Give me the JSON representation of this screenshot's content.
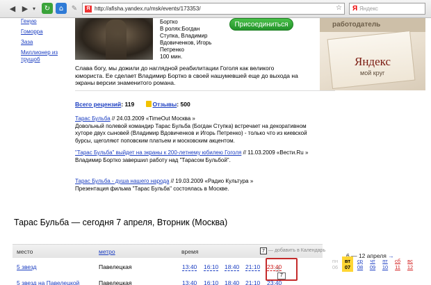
{
  "browser": {
    "url": "http://afisha.yandex.ru/msk/events/173353/",
    "favicon": "Я",
    "search_logo": "Я",
    "search_placeholder": "Яндекс",
    "icons": [
      "back-icon",
      "forward-icon",
      "dropdown-icon",
      "reload-icon",
      "home-icon",
      "pen-icon",
      "star-icon"
    ]
  },
  "sidebar": {
    "items": [
      "Геную",
      "Гоморра",
      "Заза",
      "Миллионер из трущоб"
    ]
  },
  "movie": {
    "meta_lines": [
      "Бортко",
      "В ролях:Богдан",
      "Ступка, Владимир",
      "Вдовиченков, Игорь",
      "Петренко",
      "100 мин."
    ],
    "join_button": "Присоединиться",
    "description": "Слава богу, мы дожили до наглядной реабилитации Гоголя как великого юмориста. Ее сделает Владимир Бортко в своей нашумевшей еще до выхода на экраны версии знаменитого романа."
  },
  "reviews": {
    "total_label": "Всего рецензий",
    "total_count": ": 119",
    "otzyvy_label": "Отзывы",
    "otzyvy_count": ": 500",
    "items": [
      {
        "link": "Тарас Бульба",
        "source": " // 24.03.2009 «TimeOut Москва »",
        "text": "Довольный полевой командир Тарас Бульба (Богдан Ступка) встречает на декоративном хуторе двух сыновей (Владимир Вдовиченков и Игорь Петренко) - только что из киевской бурсы, щеголяют поповским платьем и московским акцентом."
      },
      {
        "link": "\"Тарас Бульба\" выйдет на экраны к 200-летнему юбилею Гоголя",
        "source": " // 11.03.2009 «Вести.Ru »",
        "text": "Владимир Бортко завершил работу над \"Тарасом Бульбой\"."
      },
      {
        "link": "Тарас Бульба - душа нашего народа",
        "source": " // 19.03.2009 «Радио Культура »",
        "text": "Презентация фильма \"Тарас Бульба\" состоялась в Москве."
      }
    ]
  },
  "ad": {
    "top_text": "работодатель",
    "logo": "Яндекс",
    "subtitle": "мой круг"
  },
  "showtimes": {
    "title": "Тарас Бульба — сегодня 7 апреля, Вторник (Москва)",
    "columns": {
      "place": "место",
      "metro": "метро",
      "time": "время"
    },
    "calendar_icon": "7",
    "calendar_link": "— добавить в Календарь",
    "rows": [
      {
        "place": "5 звезд",
        "metro": "Павелецкая",
        "times": [
          "13:40",
          "16:10",
          "18:40",
          "21:10",
          "23:40"
        ]
      },
      {
        "place": "5 звезд на Павелецкой",
        "metro": "Павелецкая",
        "times": [
          "13:40",
          "16:10",
          "18:40",
          "21:10",
          "23:40"
        ]
      }
    ],
    "tooltip_icon": "7"
  },
  "week": {
    "title": "6 — 12 апреля",
    "arrow": "→",
    "days": [
      {
        "name": "пн",
        "num": "06",
        "state": "dim"
      },
      {
        "name": "вт",
        "num": "07",
        "state": "today"
      },
      {
        "name": "ср",
        "num": "08",
        "state": "link"
      },
      {
        "name": "чт",
        "num": "09",
        "state": "link"
      },
      {
        "name": "пт",
        "num": "10",
        "state": "link"
      },
      {
        "name": "сб",
        "num": "11",
        "state": "red"
      },
      {
        "name": "вс",
        "num": "12",
        "state": "red"
      }
    ]
  }
}
